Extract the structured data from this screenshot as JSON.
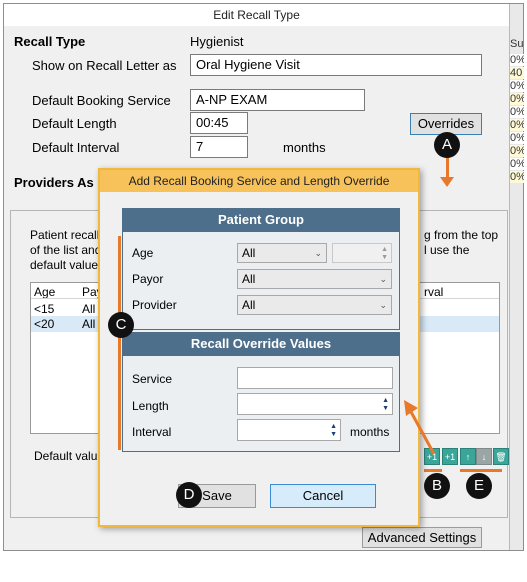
{
  "window": {
    "title": "Edit Recall Type"
  },
  "recall_type": {
    "label": "Recall Type",
    "value": "Hygienist",
    "show_on_letter_label": "Show on Recall Letter as",
    "show_on_letter_value": "Oral Hygiene Visit",
    "booking_service_label": "Default Booking Service",
    "booking_service_value": "A-NP EXAM",
    "length_label": "Default Length",
    "length_value": "00:45",
    "interval_label": "Default Interval",
    "interval_value": "7",
    "interval_unit": "months",
    "overrides_button": "Overrides"
  },
  "providers_heading": "Providers As",
  "background_panel": {
    "info_text_left_1": "Patient recall",
    "info_text_left_2": "of the list and",
    "info_text_left_3": "default values",
    "info_text_right_1": "g from the top",
    "info_text_right_2": "l use the",
    "columns": [
      "Age",
      "Pay",
      "rval"
    ],
    "rows": [
      {
        "age": "<15",
        "payor": "All"
      },
      {
        "age": "<20",
        "payor": "All"
      }
    ],
    "default_values_label": "Default valu",
    "advanced_settings_button": "Advanced Settings"
  },
  "side_values": [
    "Su",
    "0%",
    "40",
    "0%",
    "0%",
    "0%",
    "0%",
    "0%",
    "0%",
    "0%",
    "0%",
    "0%",
    "0%"
  ],
  "dialog": {
    "title": "Add Recall Booking Service and Length Override",
    "patient_group": {
      "heading": "Patient Group",
      "age_label": "Age",
      "age_value": "All",
      "payor_label": "Payor",
      "payor_value": "All",
      "provider_label": "Provider",
      "provider_value": "All"
    },
    "override_values": {
      "heading": "Recall Override Values",
      "service_label": "Service",
      "length_label": "Length",
      "interval_label": "Interval",
      "interval_unit": "months"
    },
    "save_button": "Save",
    "cancel_button": "Cancel"
  },
  "toolbar": [
    "+1",
    "+1",
    "↑",
    "↓",
    "🗑"
  ],
  "markers": {
    "a": "A",
    "b": "B",
    "c": "C",
    "d": "D",
    "e": "E"
  },
  "colors": {
    "accent_orange": "#e8782a",
    "header_blue": "#4e6f8b",
    "toolbar_teal": "#3aa69a",
    "dialog_border": "#f0b83f"
  }
}
